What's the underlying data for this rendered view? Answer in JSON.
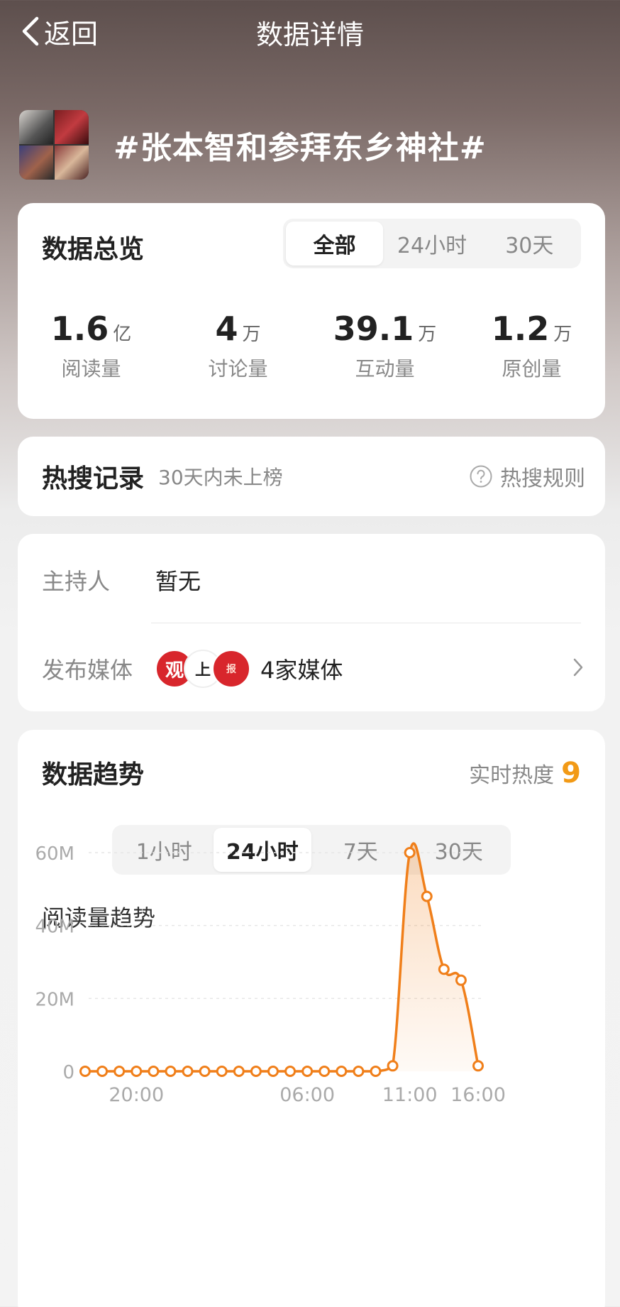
{
  "nav": {
    "back_label": "返回",
    "title": "数据详情"
  },
  "topic": {
    "title": "#张本智和参拜东乡神社#"
  },
  "overview": {
    "heading": "数据总览",
    "tabs": [
      {
        "label": "全部",
        "active": true
      },
      {
        "label": "24小时",
        "active": false
      },
      {
        "label": "30天",
        "active": false
      }
    ],
    "stats": [
      {
        "value": "1.6",
        "unit": "亿",
        "label": "阅读量"
      },
      {
        "value": "4",
        "unit": "万",
        "label": "讨论量"
      },
      {
        "value": "39.1",
        "unit": "万",
        "label": "互动量"
      },
      {
        "value": "1.2",
        "unit": "万",
        "label": "原创量"
      }
    ]
  },
  "hot": {
    "heading": "热搜记录",
    "status": "30天内未上榜",
    "rules_label": "热搜规则",
    "rules_icon": "help-circle-icon"
  },
  "info": {
    "host_key": "主持人",
    "host_value": "暂无",
    "media_key": "发布媒体",
    "media_logos": [
      "观",
      "上",
      "报"
    ],
    "media_count": "4家媒体"
  },
  "trend": {
    "heading": "数据趋势",
    "heat_label": "实时热度",
    "heat_value": "9",
    "tabs": [
      {
        "label": "1小时",
        "active": false
      },
      {
        "label": "24小时",
        "active": true
      },
      {
        "label": "7天",
        "active": false
      },
      {
        "label": "30天",
        "active": false
      }
    ],
    "chart_title": "阅读量趋势"
  },
  "colors": {
    "accent": "#f07f1a",
    "heat": "#f29a16"
  },
  "chart_data": {
    "type": "area",
    "title": "阅读量趋势",
    "xlabel": "",
    "ylabel": "",
    "ylim": [
      0,
      60
    ],
    "y_ticks": [
      "0",
      "20M",
      "40M",
      "60M"
    ],
    "y_tick_values": [
      0,
      20,
      40,
      60
    ],
    "x_tick_labels": [
      "20:00",
      "06:00",
      "11:00",
      "16:00"
    ],
    "x_tick_indices": [
      3,
      13,
      19,
      23
    ],
    "grid": true,
    "series": [
      {
        "values": [
          0,
          0,
          0,
          0,
          0,
          0,
          0,
          0,
          0,
          0,
          0,
          0,
          0,
          0,
          0,
          0,
          0,
          0,
          1.5,
          60,
          48,
          28,
          25,
          1.5
        ]
      }
    ]
  }
}
